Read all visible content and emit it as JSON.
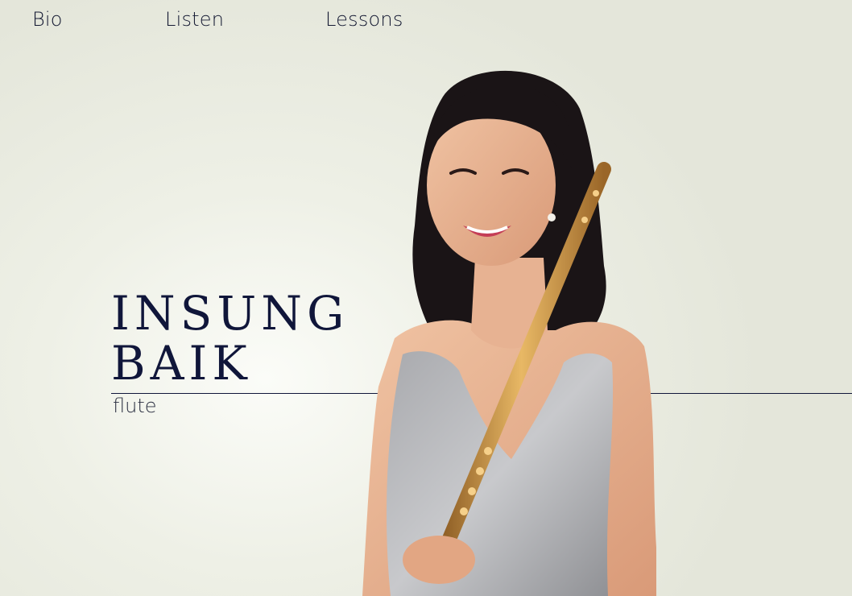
{
  "nav": {
    "items": [
      {
        "label": "Bio"
      },
      {
        "label": "Listen"
      },
      {
        "label": "Lessons"
      }
    ]
  },
  "hero": {
    "name_line1": "INSUNG",
    "name_line2": "BAIK",
    "subtitle": "flute"
  },
  "colors": {
    "background": "#e8eadf",
    "text": "#10163a",
    "flute": "#c99544"
  }
}
